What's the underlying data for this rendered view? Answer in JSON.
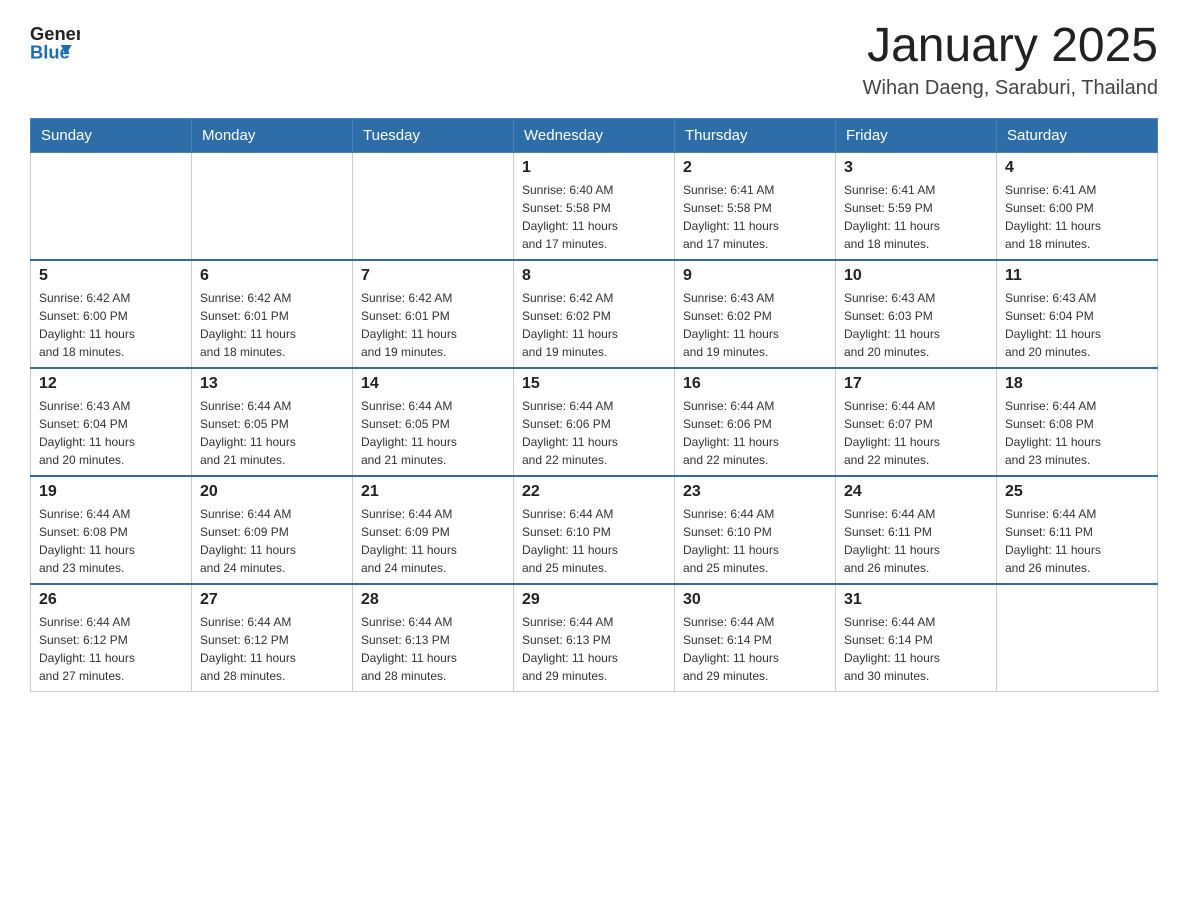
{
  "header": {
    "logo_general": "General",
    "logo_blue": "Blue",
    "title": "January 2025",
    "subtitle": "Wihan Daeng, Saraburi, Thailand"
  },
  "weekdays": [
    "Sunday",
    "Monday",
    "Tuesday",
    "Wednesday",
    "Thursday",
    "Friday",
    "Saturday"
  ],
  "weeks": [
    [
      {
        "day": "",
        "info": ""
      },
      {
        "day": "",
        "info": ""
      },
      {
        "day": "",
        "info": ""
      },
      {
        "day": "1",
        "info": "Sunrise: 6:40 AM\nSunset: 5:58 PM\nDaylight: 11 hours\nand 17 minutes."
      },
      {
        "day": "2",
        "info": "Sunrise: 6:41 AM\nSunset: 5:58 PM\nDaylight: 11 hours\nand 17 minutes."
      },
      {
        "day": "3",
        "info": "Sunrise: 6:41 AM\nSunset: 5:59 PM\nDaylight: 11 hours\nand 18 minutes."
      },
      {
        "day": "4",
        "info": "Sunrise: 6:41 AM\nSunset: 6:00 PM\nDaylight: 11 hours\nand 18 minutes."
      }
    ],
    [
      {
        "day": "5",
        "info": "Sunrise: 6:42 AM\nSunset: 6:00 PM\nDaylight: 11 hours\nand 18 minutes."
      },
      {
        "day": "6",
        "info": "Sunrise: 6:42 AM\nSunset: 6:01 PM\nDaylight: 11 hours\nand 18 minutes."
      },
      {
        "day": "7",
        "info": "Sunrise: 6:42 AM\nSunset: 6:01 PM\nDaylight: 11 hours\nand 19 minutes."
      },
      {
        "day": "8",
        "info": "Sunrise: 6:42 AM\nSunset: 6:02 PM\nDaylight: 11 hours\nand 19 minutes."
      },
      {
        "day": "9",
        "info": "Sunrise: 6:43 AM\nSunset: 6:02 PM\nDaylight: 11 hours\nand 19 minutes."
      },
      {
        "day": "10",
        "info": "Sunrise: 6:43 AM\nSunset: 6:03 PM\nDaylight: 11 hours\nand 20 minutes."
      },
      {
        "day": "11",
        "info": "Sunrise: 6:43 AM\nSunset: 6:04 PM\nDaylight: 11 hours\nand 20 minutes."
      }
    ],
    [
      {
        "day": "12",
        "info": "Sunrise: 6:43 AM\nSunset: 6:04 PM\nDaylight: 11 hours\nand 20 minutes."
      },
      {
        "day": "13",
        "info": "Sunrise: 6:44 AM\nSunset: 6:05 PM\nDaylight: 11 hours\nand 21 minutes."
      },
      {
        "day": "14",
        "info": "Sunrise: 6:44 AM\nSunset: 6:05 PM\nDaylight: 11 hours\nand 21 minutes."
      },
      {
        "day": "15",
        "info": "Sunrise: 6:44 AM\nSunset: 6:06 PM\nDaylight: 11 hours\nand 22 minutes."
      },
      {
        "day": "16",
        "info": "Sunrise: 6:44 AM\nSunset: 6:06 PM\nDaylight: 11 hours\nand 22 minutes."
      },
      {
        "day": "17",
        "info": "Sunrise: 6:44 AM\nSunset: 6:07 PM\nDaylight: 11 hours\nand 22 minutes."
      },
      {
        "day": "18",
        "info": "Sunrise: 6:44 AM\nSunset: 6:08 PM\nDaylight: 11 hours\nand 23 minutes."
      }
    ],
    [
      {
        "day": "19",
        "info": "Sunrise: 6:44 AM\nSunset: 6:08 PM\nDaylight: 11 hours\nand 23 minutes."
      },
      {
        "day": "20",
        "info": "Sunrise: 6:44 AM\nSunset: 6:09 PM\nDaylight: 11 hours\nand 24 minutes."
      },
      {
        "day": "21",
        "info": "Sunrise: 6:44 AM\nSunset: 6:09 PM\nDaylight: 11 hours\nand 24 minutes."
      },
      {
        "day": "22",
        "info": "Sunrise: 6:44 AM\nSunset: 6:10 PM\nDaylight: 11 hours\nand 25 minutes."
      },
      {
        "day": "23",
        "info": "Sunrise: 6:44 AM\nSunset: 6:10 PM\nDaylight: 11 hours\nand 25 minutes."
      },
      {
        "day": "24",
        "info": "Sunrise: 6:44 AM\nSunset: 6:11 PM\nDaylight: 11 hours\nand 26 minutes."
      },
      {
        "day": "25",
        "info": "Sunrise: 6:44 AM\nSunset: 6:11 PM\nDaylight: 11 hours\nand 26 minutes."
      }
    ],
    [
      {
        "day": "26",
        "info": "Sunrise: 6:44 AM\nSunset: 6:12 PM\nDaylight: 11 hours\nand 27 minutes."
      },
      {
        "day": "27",
        "info": "Sunrise: 6:44 AM\nSunset: 6:12 PM\nDaylight: 11 hours\nand 28 minutes."
      },
      {
        "day": "28",
        "info": "Sunrise: 6:44 AM\nSunset: 6:13 PM\nDaylight: 11 hours\nand 28 minutes."
      },
      {
        "day": "29",
        "info": "Sunrise: 6:44 AM\nSunset: 6:13 PM\nDaylight: 11 hours\nand 29 minutes."
      },
      {
        "day": "30",
        "info": "Sunrise: 6:44 AM\nSunset: 6:14 PM\nDaylight: 11 hours\nand 29 minutes."
      },
      {
        "day": "31",
        "info": "Sunrise: 6:44 AM\nSunset: 6:14 PM\nDaylight: 11 hours\nand 30 minutes."
      },
      {
        "day": "",
        "info": ""
      }
    ]
  ]
}
